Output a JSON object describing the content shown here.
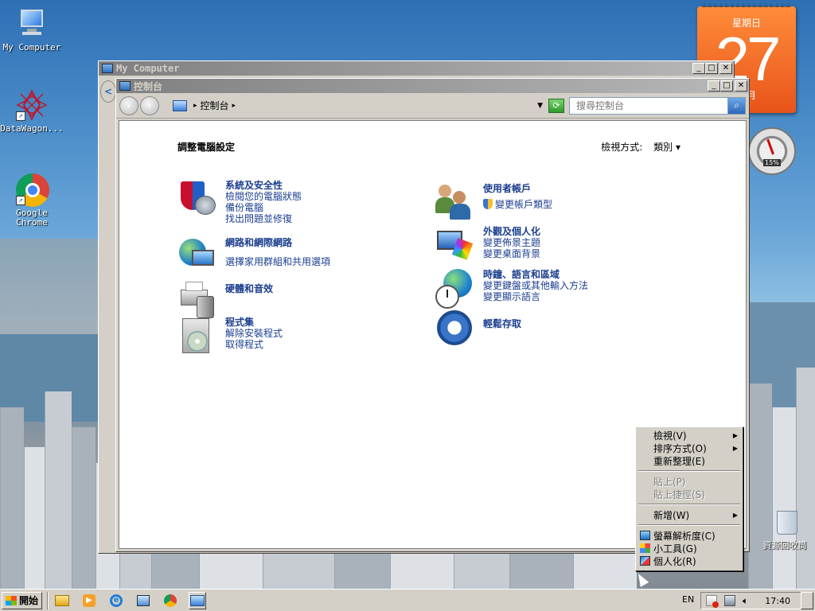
{
  "desktop": {
    "icons": [
      {
        "label": "My Computer"
      },
      {
        "label": "DataWagon..."
      },
      {
        "label": "Google\nChrome"
      },
      {
        "label": "資源回收筒"
      }
    ]
  },
  "calendar": {
    "weekday": "星期日",
    "day": "27",
    "month": "三月",
    "rings": "┴┴┴┴┴┴┴┴┴┴┴┴┴┴┴┴"
  },
  "meter": {
    "value": "15%",
    "fraction": 0.15
  },
  "my_computer_window": {
    "title": "My Computer"
  },
  "control_panel": {
    "title": "控制台",
    "address_segment": "控制台",
    "search_placeholder": "搜尋控制台",
    "heading": "調整電腦設定",
    "view_by_label": "檢視方式:",
    "view_by_value": "類別",
    "left_categories": [
      {
        "heading": "系統及安全性",
        "links": [
          "檢閱您的電腦狀態",
          "備份電腦",
          "找出問題並修復"
        ]
      },
      {
        "heading": "網路和網際網路",
        "links": [
          "選擇家用群組和共用選項"
        ]
      },
      {
        "heading": "硬體和音效",
        "links": []
      },
      {
        "heading": "程式集",
        "links": [
          "解除安裝程式",
          "取得程式"
        ]
      }
    ],
    "right_categories": [
      {
        "heading": "使用者帳戶",
        "links": [
          "變更帳戶類型"
        ]
      },
      {
        "heading": "外觀及個人化",
        "links": [
          "變更佈景主題",
          "變更桌面背景"
        ]
      },
      {
        "heading": "時鐘、語言和區域",
        "links": [
          "變更鍵盤或其他輸入方法",
          "變更顯示語言"
        ]
      },
      {
        "heading": "輕鬆存取",
        "links": []
      }
    ]
  },
  "context_menu": {
    "items": [
      {
        "label": "檢視(V)"
      },
      {
        "label": "排序方式(O)"
      },
      {
        "label": "重新整理(E)"
      },
      {
        "label": "貼上(P)"
      },
      {
        "label": "貼上捷徑(S)"
      },
      {
        "label": "新增(W)"
      },
      {
        "label": "螢幕解析度(C)"
      },
      {
        "label": "小工具(G)"
      },
      {
        "label": "個人化(R)"
      }
    ]
  },
  "taskbar": {
    "start_label": "開始",
    "language": "EN",
    "clock": "17:40"
  },
  "colors": {
    "accent": "#2d66b8",
    "calendar": "#e8541a",
    "link": "#1b3e8e"
  }
}
